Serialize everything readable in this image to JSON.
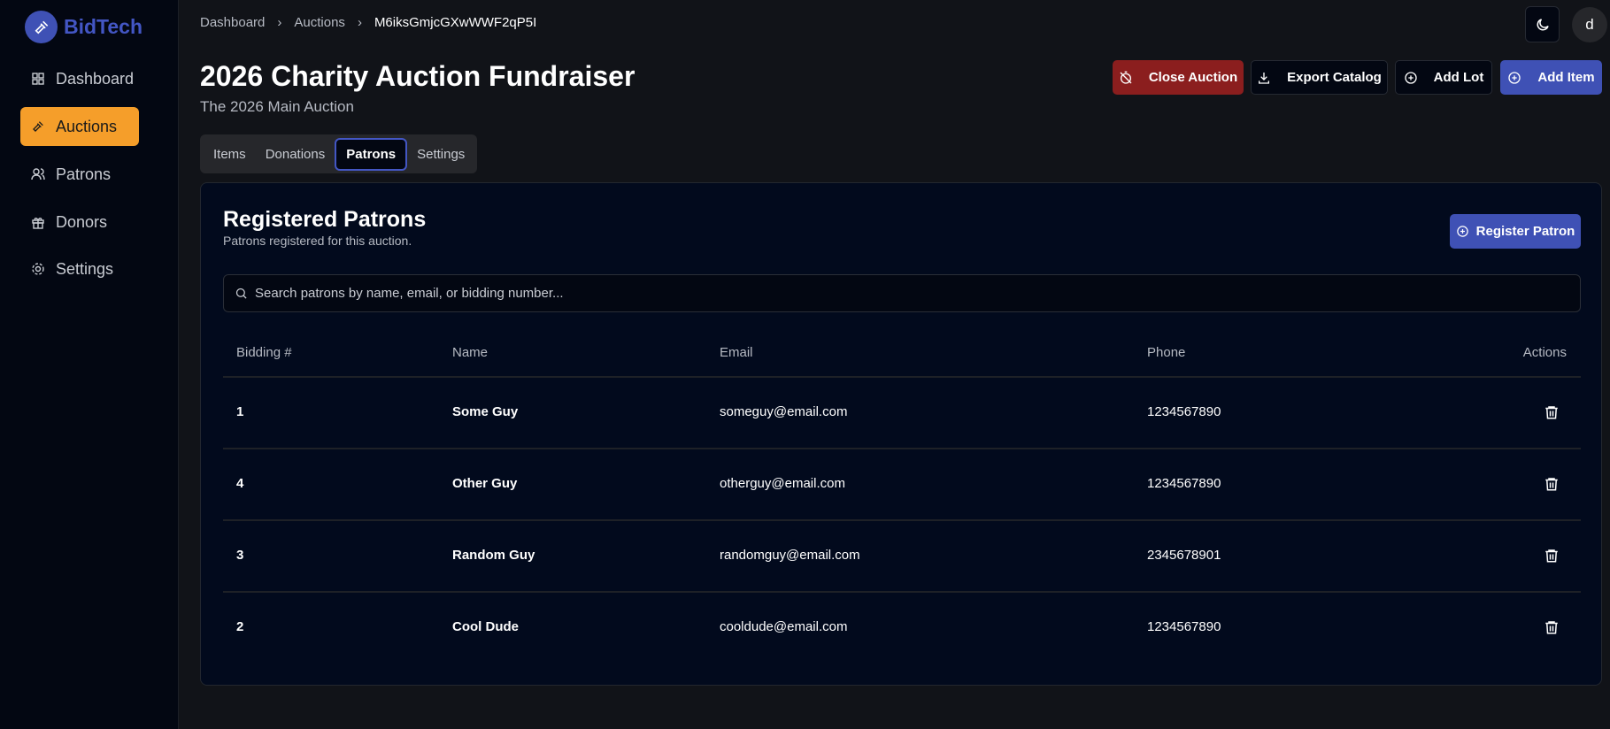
{
  "app": {
    "brand": "BidTech"
  },
  "sidebar": {
    "items": [
      {
        "label": "Dashboard",
        "icon": "grid-icon"
      },
      {
        "label": "Auctions",
        "icon": "gavel-icon",
        "active": true
      },
      {
        "label": "Patrons",
        "icon": "users-icon"
      },
      {
        "label": "Donors",
        "icon": "gift-icon"
      },
      {
        "label": "Settings",
        "icon": "gear-icon"
      }
    ]
  },
  "breadcrumb": [
    "Dashboard",
    "Auctions",
    "M6iksGmjcGXwWWF2qP5I"
  ],
  "header": {
    "title": "2026 Charity Auction Fundraiser",
    "subtitle": "The 2026 Main Auction",
    "avatar": "d"
  },
  "actions": {
    "close": "Close Auction",
    "export": "Export Catalog",
    "add_lot": "Add Lot",
    "add_item": "Add Item"
  },
  "tabs": [
    "Items",
    "Donations",
    "Patrons",
    "Settings"
  ],
  "patrons": {
    "title": "Registered Patrons",
    "subtitle": "Patrons registered for this auction.",
    "register": "Register Patron",
    "search_placeholder": "Search patrons by name, email, or bidding number...",
    "columns": [
      "Bidding #",
      "Name",
      "Email",
      "Phone",
      "Actions"
    ],
    "rows": [
      {
        "num": "1",
        "name": "Some Guy",
        "email": "someguy@email.com",
        "phone": "1234567890"
      },
      {
        "num": "4",
        "name": "Other Guy",
        "email": "otherguy@email.com",
        "phone": "1234567890"
      },
      {
        "num": "3",
        "name": "Random Guy",
        "email": "randomguy@email.com",
        "phone": "2345678901"
      },
      {
        "num": "2",
        "name": "Cool Dude",
        "email": "cooldude@email.com",
        "phone": "1234567890"
      }
    ]
  },
  "colors": {
    "accent": "#f59e2a",
    "primary": "#3f51b5",
    "danger": "#8b1e1e"
  }
}
